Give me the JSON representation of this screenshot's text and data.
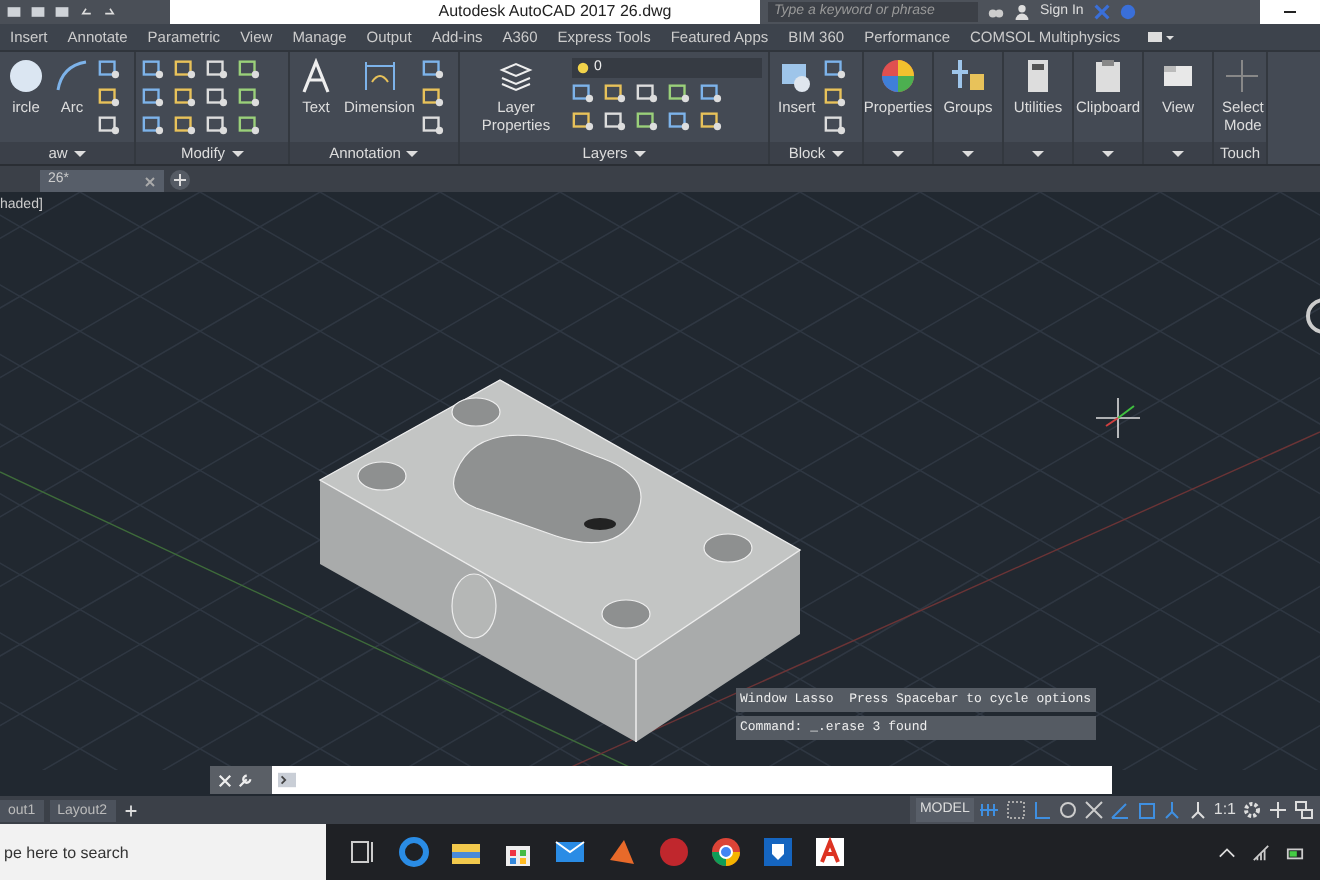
{
  "title_bar": {
    "title": "Autodesk AutoCAD 2017",
    "file": "26.dwg",
    "search": {
      "placeholder": "Type a keyword or phrase"
    },
    "sign_in": "Sign In"
  },
  "ribbon_tabs": [
    {
      "label": "Insert",
      "selected": false
    },
    {
      "label": "Annotate",
      "selected": false
    },
    {
      "label": "Parametric",
      "selected": false
    },
    {
      "label": "View",
      "selected": false
    },
    {
      "label": "Manage",
      "selected": false
    },
    {
      "label": "Output",
      "selected": false
    },
    {
      "label": "Add-ins",
      "selected": false
    },
    {
      "label": "A360",
      "selected": false
    },
    {
      "label": "Express Tools",
      "selected": false
    },
    {
      "label": "Featured Apps",
      "selected": false
    },
    {
      "label": "BIM 360",
      "selected": false
    },
    {
      "label": "Performance",
      "selected": false
    },
    {
      "label": "COMSOL Multiphysics",
      "selected": false
    }
  ],
  "ribbon_panels": [
    {
      "kind": "draw",
      "title": "aw",
      "buttons": [
        "ircle",
        "Arc"
      ]
    },
    {
      "kind": "modify",
      "title": "Modify"
    },
    {
      "kind": "annotation",
      "title": "Annotation",
      "buttons": [
        "Text",
        "Dimension"
      ]
    },
    {
      "kind": "layers",
      "title": "Layers",
      "buttons": [
        "Layer Properties"
      ],
      "layer": "0"
    },
    {
      "kind": "block",
      "title": "Block",
      "buttons": [
        "Insert"
      ]
    },
    {
      "kind": "single",
      "buttons": [
        "Properties"
      ]
    },
    {
      "kind": "single",
      "buttons": [
        "Groups"
      ]
    },
    {
      "kind": "single",
      "buttons": [
        "Utilities"
      ]
    },
    {
      "kind": "single",
      "buttons": [
        "Clipboard"
      ]
    },
    {
      "kind": "single",
      "buttons": [
        "View"
      ]
    },
    {
      "kind": "touch",
      "title": "Touch",
      "buttons": [
        "Select Mode"
      ]
    }
  ],
  "file_tabs": [
    {
      "label": "26*",
      "selected": true
    }
  ],
  "viewport": {
    "view_label": "haded]"
  },
  "command_history": [
    "Window Lasso  Press Spacebar to cycle options",
    "Command: _.erase 3 found"
  ],
  "layout_tabs": [
    {
      "label": "out1",
      "selected": false
    },
    {
      "label": "Layout2",
      "selected": false
    }
  ],
  "status_bar": {
    "model": "MODEL",
    "scale": "1:1"
  },
  "taskbar": {
    "search": {
      "placeholder": "pe here to search"
    }
  }
}
